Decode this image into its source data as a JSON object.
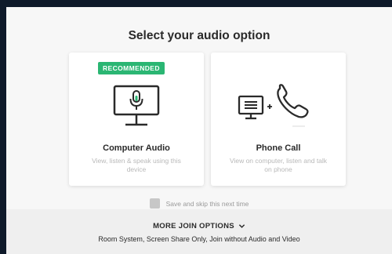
{
  "dialog": {
    "title": "Select your audio option"
  },
  "options": [
    {
      "badge": "RECOMMENDED",
      "title": "Computer Audio",
      "description": "View, listen & speak using this device",
      "icon": "monitor-microphone-icon"
    },
    {
      "title": "Phone Call",
      "description": "View on computer, listen and talk on phone",
      "icon": "computer-plus-phone-icon"
    }
  ],
  "skip": {
    "label": "Save and skip this next time",
    "checked": false
  },
  "more": {
    "label": "MORE JOIN OPTIONS",
    "icon": "chevron-down-icon",
    "description": "Room System, Screen Share Only, Join without Audio and Video"
  },
  "colors": {
    "accent": "#2bb673",
    "background": "#f7f7f7",
    "text": "#2a2a2a",
    "muted": "#b9b9b9"
  }
}
